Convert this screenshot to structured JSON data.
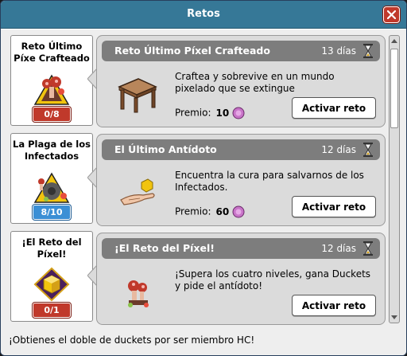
{
  "window": {
    "title": "Retos"
  },
  "challenges": [
    {
      "card_title": "Reto Último Píxe Crafteado",
      "progress": "0/8",
      "badge_color": "red",
      "header": "Reto Último Píxel Crafteado",
      "days": "13 días",
      "description": "Craftea y sobrevive en un mundo pixelado que se extingue",
      "premio_label": "Premio:",
      "premio_amount": "10",
      "button": "Activar reto",
      "image": "wooden-stool"
    },
    {
      "card_title": "La Plaga de los Infectados",
      "progress": "8/10",
      "badge_color": "blue",
      "header": "El Último Antídoto",
      "days": "12 días",
      "description": "Encuentra la cura para salvarnos de los Infectados.",
      "premio_label": "Premio:",
      "premio_amount": "60",
      "button": "Activar reto",
      "image": "hand-with-cube"
    },
    {
      "card_title": "¡El Reto del Píxel!",
      "progress": "0/1",
      "badge_color": "red",
      "header": "¡El Reto del Píxel!",
      "days": "12 días",
      "description": "¡Supera los cuatro niveles, gana Duckets y pide el antídoto!",
      "button": "Activar reto",
      "image": "mushroom-creature"
    }
  ],
  "footer": "¡Obtienes el doble de duckets por ser miembro HC!",
  "colors": {
    "titlebar": "#367897",
    "close": "#c0392b",
    "badge_red": "#c0392b",
    "badge_blue": "#3b8fd5",
    "duckets": "#c874c8"
  }
}
